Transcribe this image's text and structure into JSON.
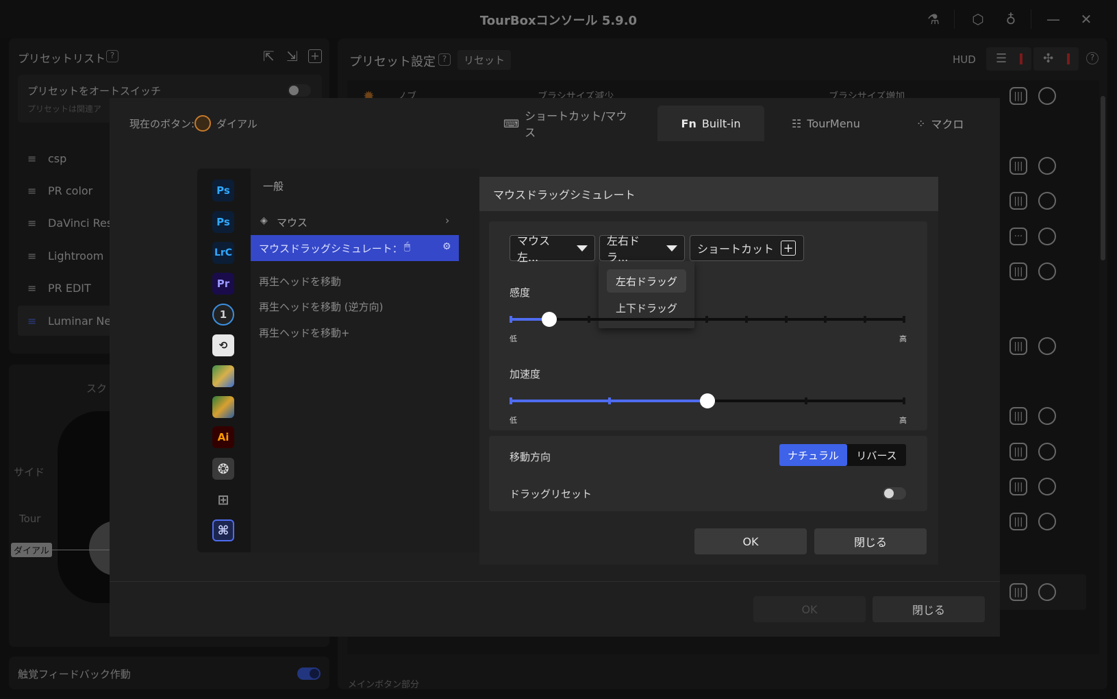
{
  "window": {
    "title": "TourBoxコンソール 5.9.0"
  },
  "presets": {
    "header": "プリセットリスト",
    "auto_switch": "プリセットをオートスイッチ",
    "auto_switch_sub": "プリセットは関連ア",
    "items": [
      {
        "label": "csp"
      },
      {
        "label": "PR color"
      },
      {
        "label": "DaVinci Resc"
      },
      {
        "label": "Lightroom"
      },
      {
        "label": "PR EDIT"
      },
      {
        "label": "Luminar Nec"
      }
    ]
  },
  "device": {
    "label_scroll": "スク",
    "label_side": "サイド",
    "label_tour": "Tour",
    "label_dial": "ダイアル"
  },
  "haptic": {
    "label": "触覚フィードバック作動"
  },
  "preset_settings": {
    "header": "プリセット設定",
    "reset": "リセット",
    "hud": "HUD",
    "row_prefix": "ノブ",
    "row_dec": "ブラシサイズ減少",
    "row_inc": "ブラシサイズ増加",
    "bottom_section": "メインボタン部分"
  },
  "dialog": {
    "current_button_label": "現在のボタン:",
    "current_button_value": "ダイアル",
    "tabs": [
      {
        "label": "ショートカット/マウス",
        "icon": "keyboard-icon"
      },
      {
        "label": "Built-in",
        "icon": "fn-icon"
      },
      {
        "label": "TourMenu",
        "icon": "menu-icon"
      },
      {
        "label": "マクロ",
        "icon": "macro-icon"
      }
    ],
    "apps": [
      "Ps",
      "Ps",
      "LrC",
      "Pr",
      "1",
      "",
      "",
      "",
      "Ai",
      "",
      "",
      "⌘"
    ],
    "category_header": "一般",
    "category_mouse": "マウス",
    "selected_item": "マウスドラッグシミュレート：",
    "items": [
      "再生ヘッドを移動",
      "再生ヘッドを移動 (逆方向)",
      "再生ヘッドを移動+"
    ],
    "ok": "OK",
    "close": "閉じる"
  },
  "drag_sim": {
    "title": "マウスドラッグシミュレート",
    "dropdown_button": "マウス左...",
    "dropdown_mode": "左右ドラ...",
    "shortcut_label": "ショートカット",
    "menu_options": [
      "左右ドラッグ",
      "上下ドラッグ"
    ],
    "sensitivity_label": "感度",
    "sensitivity_value": 0.1,
    "acceleration_label": "加速度",
    "acceleration_value": 0.5,
    "low": "低",
    "high": "高",
    "direction_label": "移動方向",
    "direction_natural": "ナチュラル",
    "direction_reverse": "リバース",
    "drag_reset_label": "ドラッグリセット",
    "ok": "OK",
    "close": "閉じる"
  },
  "colors": {
    "accent": "#4f6cf0",
    "selected": "#3548c9"
  }
}
